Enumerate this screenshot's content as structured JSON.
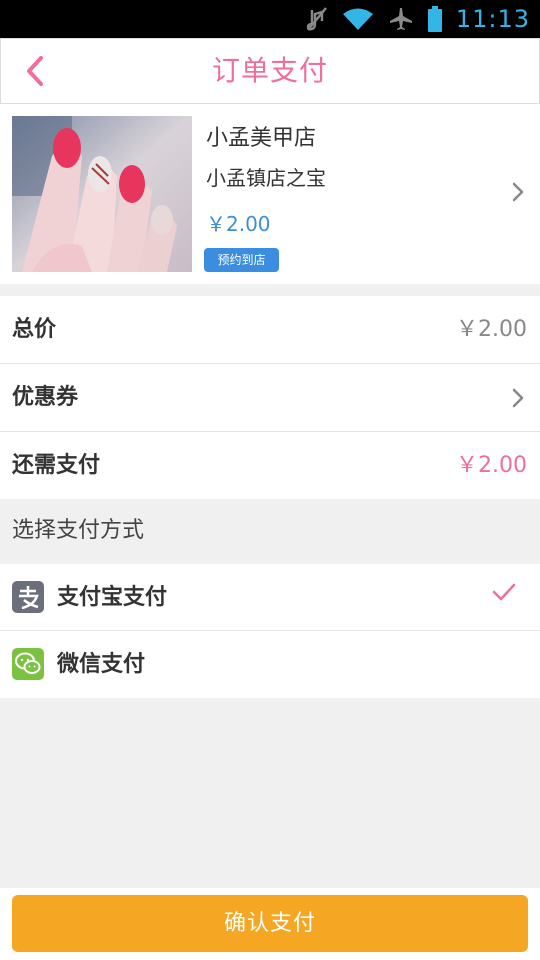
{
  "status_bar": {
    "time": "11:13",
    "icons": [
      "mute-icon",
      "wifi-icon",
      "airplane-icon",
      "battery-icon"
    ],
    "accent_color": "#33b5e5"
  },
  "header": {
    "title": "订单支付",
    "back_icon": "chevron-left-icon",
    "accent_color": "#f06e9e"
  },
  "product": {
    "shop_name": "小孟美甲店",
    "product_name": "小孟镇店之宝",
    "price": "￥2.00",
    "badge": "预约到店",
    "arrow_icon": "chevron-right-icon"
  },
  "summary": {
    "total": {
      "label": "总价",
      "value": "￥2.00"
    },
    "coupon": {
      "label": "优惠券",
      "arrow_icon": "chevron-right-icon"
    },
    "remaining": {
      "label": "还需支付",
      "value": "￥2.00"
    }
  },
  "payment": {
    "section_title": "选择支付方式",
    "methods": [
      {
        "label": "支付宝支付",
        "icon": "alipay-icon",
        "selected": true
      },
      {
        "label": "微信支付",
        "icon": "wechat-icon",
        "selected": false
      }
    ],
    "check_icon": "checkmark-icon"
  },
  "footer": {
    "confirm_label": "确认支付",
    "button_color": "#f5a623"
  }
}
